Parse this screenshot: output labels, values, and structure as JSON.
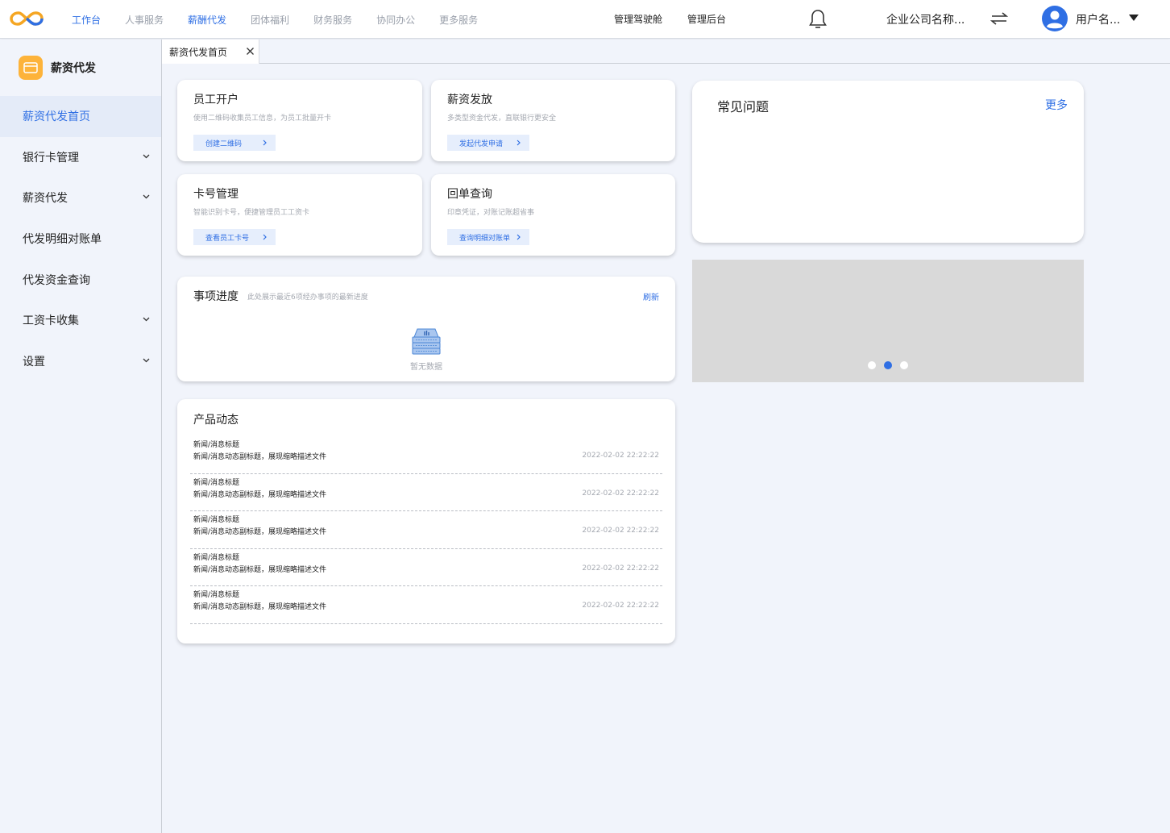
{
  "topbar": {
    "nav": [
      {
        "label": "工作台",
        "active": true
      },
      {
        "label": "人事服务",
        "active": false
      },
      {
        "label": "薪酬代发",
        "active": true
      },
      {
        "label": "团体福利",
        "active": false
      },
      {
        "label": "财务服务",
        "active": false
      },
      {
        "label": "协同办公",
        "active": false
      },
      {
        "label": "更多服务",
        "active": false
      }
    ],
    "cockpit": "管理驾驶舱",
    "admin": "管理后台",
    "company": "企业公司名称...",
    "username": "用户名...",
    "accent": "#2f6fe4"
  },
  "sidebar": {
    "title": "薪资代发",
    "items": [
      {
        "label": "薪资代发首页",
        "expandable": false,
        "active": true
      },
      {
        "label": "银行卡管理",
        "expandable": true,
        "active": false
      },
      {
        "label": "薪资代发",
        "expandable": true,
        "active": false
      },
      {
        "label": "代发明细对账单",
        "expandable": false,
        "active": false
      },
      {
        "label": "代发资金查询",
        "expandable": false,
        "active": false
      },
      {
        "label": "工资卡收集",
        "expandable": true,
        "active": false
      },
      {
        "label": "设置",
        "expandable": true,
        "active": false
      }
    ]
  },
  "tabs": [
    {
      "label": "薪资代发首页"
    }
  ],
  "quick": [
    {
      "title": "员工开户",
      "desc": "使用二维码收集员工信息，为员工批量开卡",
      "btn": "创建二维码"
    },
    {
      "title": "薪资发放",
      "desc": "多类型资金代发，直联银行更安全",
      "btn": "发起代发申请"
    },
    {
      "title": "卡号管理",
      "desc": "智能识别卡号，便捷管理员工工资卡",
      "btn": "查看员工卡号"
    },
    {
      "title": "回单查询",
      "desc": "印章凭证，对账记账超省事",
      "btn": "查询明细对账单"
    }
  ],
  "progress": {
    "title": "事项进度",
    "subtitle": "此处展示最近6项经办事项的最新进度",
    "refresh": "刷新",
    "empty": "暂无数据"
  },
  "news": {
    "title": "产品动态",
    "items": [
      {
        "headline": "新闻/消息标题",
        "summary": "新闻/消息动态副标题，展现缩略描述文件",
        "time": "2022-02-02 22:22:22"
      },
      {
        "headline": "新闻/消息标题",
        "summary": "新闻/消息动态副标题，展现缩略描述文件",
        "time": "2022-02-02 22:22:22"
      },
      {
        "headline": "新闻/消息标题",
        "summary": "新闻/消息动态副标题，展现缩略描述文件",
        "time": "2022-02-02 22:22:22"
      },
      {
        "headline": "新闻/消息标题",
        "summary": "新闻/消息动态副标题，展现缩略描述文件",
        "time": "2022-02-02 22:22:22"
      },
      {
        "headline": "新闻/消息标题",
        "summary": "新闻/消息动态副标题，展现缩略描述文件",
        "time": "2022-02-02 22:22:22"
      }
    ]
  },
  "faq": {
    "title": "常见问题",
    "more": "更多"
  },
  "banner": {
    "slides": 3,
    "active_slide": 2
  }
}
